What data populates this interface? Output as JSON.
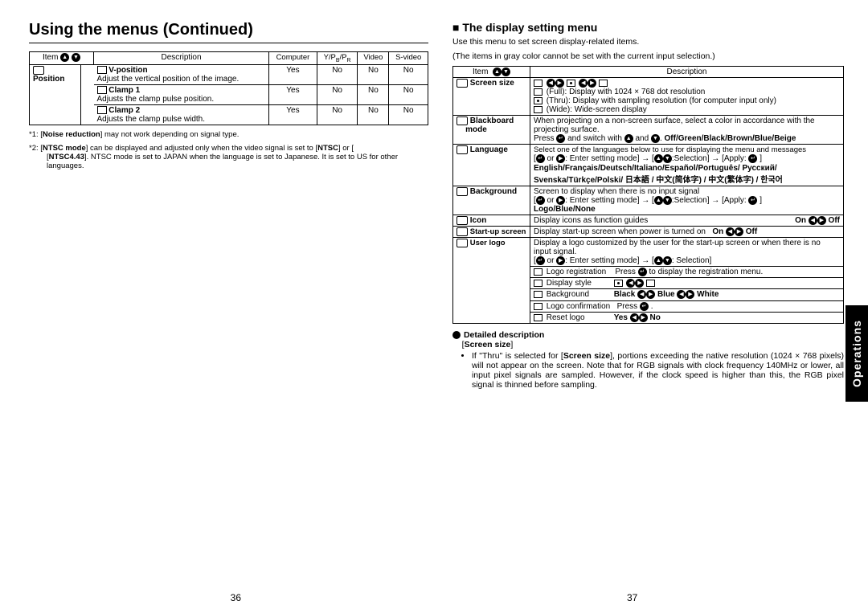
{
  "header": "Using the menus (Continued)",
  "leftTable": {
    "headers": [
      "Item",
      "Description",
      "Computer",
      "Y/P B/P R",
      "Video",
      "S-video"
    ],
    "positionLabel": "Position",
    "rows": [
      {
        "name": "V-position",
        "desc": "Adjust the vertical position of the image.",
        "vals": [
          "Yes",
          "No",
          "No",
          "No"
        ]
      },
      {
        "name": "Clamp 1",
        "desc": "Adjusts the clamp pulse position.",
        "vals": [
          "Yes",
          "No",
          "No",
          "No"
        ]
      },
      {
        "name": "Clamp 2",
        "desc": "Adjusts the clamp pulse width.",
        "vals": [
          "Yes",
          "No",
          "No",
          "No"
        ]
      }
    ]
  },
  "footnotes": {
    "f1a": "*1: [",
    "f1b": "Noise reduction",
    "f1c": "] may not work depending on signal type.",
    "f2a": "*2: [",
    "f2b": "NTSC mode",
    "f2c": "] can be displayed and adjusted only when the video signal is set to [",
    "f2d": "NTSC",
    "f2e": "] or [",
    "f2f": "NTSC4.43",
    "f2g": "]. NTSC mode is set to JAPAN when the language is set to Japanese. It is set to US for other languages."
  },
  "section2": {
    "title": "The display setting menu",
    "intro1": "Use this menu to set screen display-related items.",
    "intro2": "(The items in gray color cannot be set with the current input selection.)",
    "headers": [
      "Item",
      "Description"
    ],
    "screenSize": {
      "label": "Screen size",
      "full": "(Full):  Display with 1024 × 768 dot resolution",
      "thru": "(Thru): Display with sampling resolution (for computer input only)",
      "wide": "(Wide):  Wide-screen display"
    },
    "blackboard": {
      "label": "Blackboard",
      "label2": "mode",
      "d1": "When projecting on a non-screen surface, select a color in accordance with the projecting surface.",
      "d2a": "Press ",
      "d2b": " and switch with ",
      "d2c": " and ",
      "d2d": ".  ",
      "opts": "Off/Green/Black/Brown/Blue/Beige"
    },
    "language": {
      "label": "Language",
      "d1": "Select one of the languages below to use for displaying the menu and messages",
      "d2": ": Enter setting mode] → [",
      "d2b": ":Selection] → [Apply:",
      "langs": "English/Français/Deutsch/Italiano/Español/Português/ Русский/ Svenska/Türkçe/Polski/ 日本語 / 中文(简体字) / 中文(繁体字) / 한국어"
    },
    "background": {
      "label": "Background",
      "d1": "Screen to display when there is no input signal",
      "d2": ": Enter setting mode] → [",
      "d2b": ":Selection] → [Apply:",
      "opts": "Logo/Blue/None"
    },
    "icon": {
      "label": "Icon",
      "d": "Display icons as function guides",
      "on": "On",
      "off": "Off"
    },
    "startup": {
      "label": "Start-up screen",
      "d": "Display start-up screen when power is turned on",
      "on": "On",
      "off": "Off"
    },
    "userlogo": {
      "label": "User logo",
      "d1": "Display a logo customized by the user for the start-up screen or when there is no input signal.",
      "d2": ": Enter setting mode] → [",
      "d2b": ": Selection]",
      "rows": {
        "logoReg": {
          "k": "Logo registration",
          "v1": "Press ",
          "v2": " to display the registration menu."
        },
        "style": {
          "k": "Display style"
        },
        "bg": {
          "k": "Background",
          "b1": "Black",
          "b2": "Blue",
          "b3": "White"
        },
        "confirm": {
          "k": "Logo confirmation",
          "v": "Press "
        },
        "reset": {
          "k": "Reset logo",
          "y": "Yes",
          "n": "No"
        }
      }
    }
  },
  "detailed": {
    "head": "Detailed description",
    "sub": "Screen size",
    "body": "If \"Thru\" is selected for [Screen size], portions exceeding the native resolution (1024 × 768 pixels) will not appear on the screen. Note that for RGB signals with clock frequency 140MHz or lower, all input pixel signals are sampled. However, if the clock speed is higher than this, the RGB pixel signal is thinned before sampling.",
    "body_pre": "If \"Thru\" is selected for [",
    "body_b": "Screen size",
    "body_post": "], portions exceeding the native resolution (1024 × 768 pixels) will not appear on the screen. Note that for RGB signals with clock frequency 140MHz or lower, all input pixel signals are sampled. However, if the clock speed is higher than this, the RGB pixel signal is thinned before sampling."
  },
  "pageLeft": "36",
  "pageRight": "37",
  "sideTab": "Operations"
}
